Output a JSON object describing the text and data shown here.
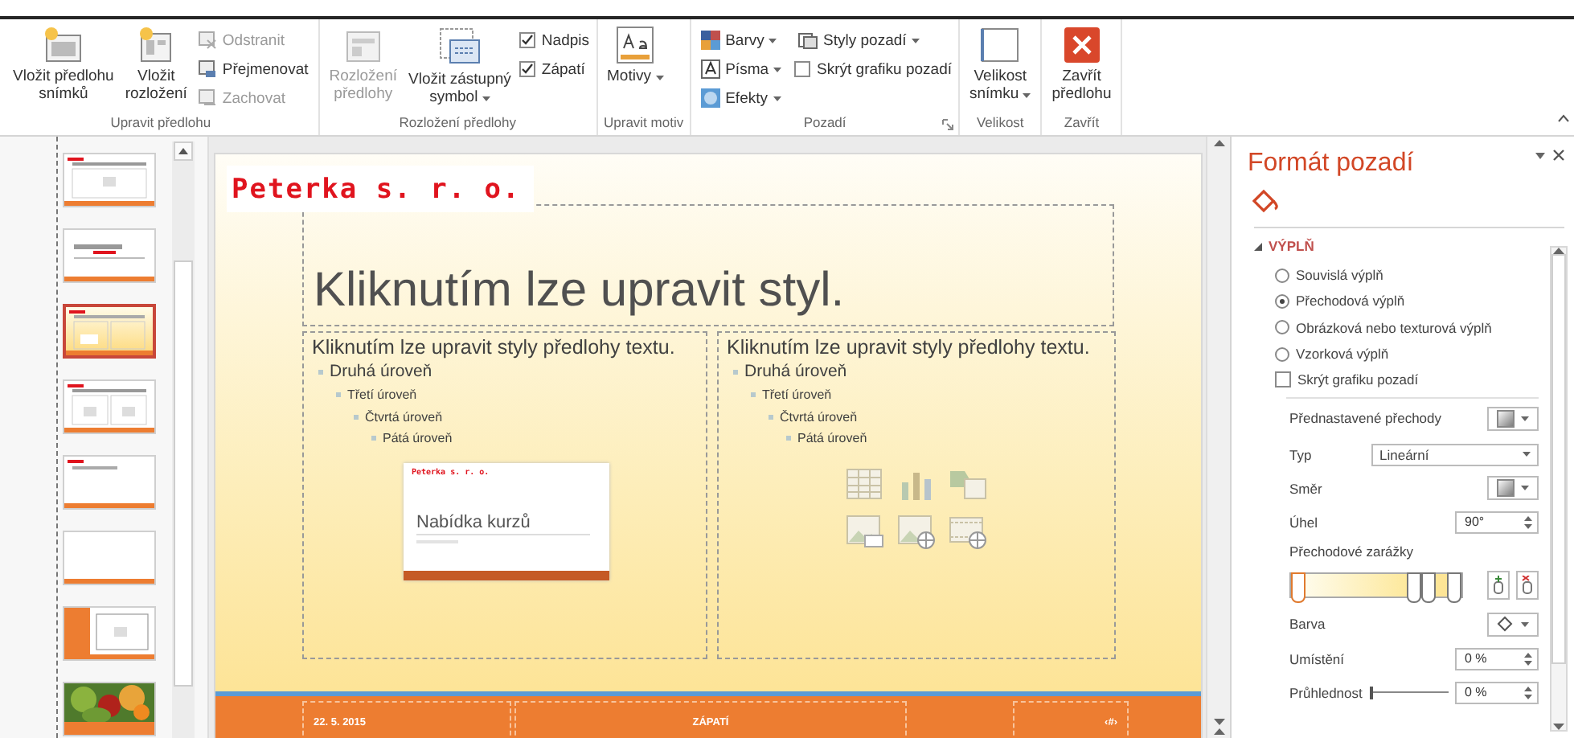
{
  "ribbon": {
    "groups": [
      {
        "label": "Upravit předlohu",
        "items": [
          {
            "kind": "large",
            "label": "Vložit předlohu\nsnímků",
            "disabled": false
          },
          {
            "kind": "large",
            "label": "Vložit\nrozložení",
            "disabled": false
          },
          {
            "kind": "small",
            "label": "Odstranit",
            "disabled": true
          },
          {
            "kind": "small",
            "label": "Přejmenovat",
            "disabled": false
          },
          {
            "kind": "small",
            "label": "Zachovat",
            "disabled": true
          }
        ]
      },
      {
        "label": "Rozložení předlohy",
        "items": [
          {
            "kind": "large",
            "label": "Rozložení\npředlohy",
            "disabled": true
          },
          {
            "kind": "large",
            "label": "Vložit zástupný\nsymbol",
            "disabled": false,
            "dropdown": true
          },
          {
            "kind": "check",
            "label": "Nadpis",
            "checked": true
          },
          {
            "kind": "check",
            "label": "Zápatí",
            "checked": true
          }
        ]
      },
      {
        "label": "Upravit motiv",
        "items": [
          {
            "kind": "large",
            "label": "Motivy",
            "disabled": false,
            "dropdown": true
          }
        ]
      },
      {
        "label": "Pozadí",
        "launcher": true,
        "items": [
          {
            "kind": "small",
            "label": "Barvy",
            "disabled": false,
            "dropdown": true
          },
          {
            "kind": "small",
            "label": "Písma",
            "disabled": false,
            "dropdown": true
          },
          {
            "kind": "small",
            "label": "Efekty",
            "disabled": false,
            "dropdown": true
          },
          {
            "kind": "small",
            "label": "Styly pozadí",
            "disabled": false,
            "dropdown": true
          },
          {
            "kind": "check",
            "label": "Skrýt grafiku pozadí",
            "checked": false
          }
        ]
      },
      {
        "label": "Velikost",
        "items": [
          {
            "kind": "large",
            "label": "Velikost\nsnímku",
            "disabled": false,
            "dropdown": true
          }
        ]
      },
      {
        "label": "Zavřít",
        "items": [
          {
            "kind": "large",
            "label": "Zavřít\npředlohu",
            "disabled": false
          }
        ]
      }
    ]
  },
  "thumbnails": [
    {
      "kind": "title-content",
      "selected": false
    },
    {
      "kind": "title",
      "selected": false
    },
    {
      "kind": "two-content",
      "selected": true
    },
    {
      "kind": "comparison",
      "selected": false
    },
    {
      "kind": "title-only",
      "selected": false
    },
    {
      "kind": "blank",
      "selected": false
    },
    {
      "kind": "content-caption",
      "selected": false
    },
    {
      "kind": "picture-caption",
      "selected": false
    }
  ],
  "slide": {
    "logo": "Peterka s. r. o.",
    "title": "Kliknutím lze upravit styl.",
    "body_boxes": [
      {
        "kind": "slide-preview",
        "outline": [
          {
            "text": "Kliknutím lze upravit styly předlohy textu.",
            "children": [
              {
                "text": "Druhá úroveň",
                "children": [
                  {
                    "text": "Třetí úroveň",
                    "children": [
                      {
                        "text": "Čtvrtá úroveň",
                        "children": [
                          {
                            "text": "Pátá úroveň"
                          }
                        ]
                      }
                    ]
                  }
                ]
              }
            ]
          }
        ],
        "preview": {
          "logo": "Peterka s. r. o.",
          "title": "Nabídka kurzů"
        }
      },
      {
        "kind": "content-icons",
        "outline": [
          {
            "text": "Kliknutím lze upravit styly předlohy textu.",
            "children": [
              {
                "text": "Druhá úroveň",
                "children": [
                  {
                    "text": "Třetí úroveň",
                    "children": [
                      {
                        "text": "Čtvrtá úroveň",
                        "children": [
                          {
                            "text": "Pátá úroveň"
                          }
                        ]
                      }
                    ]
                  }
                ]
              }
            ]
          }
        ]
      }
    ],
    "footer": {
      "date": "22. 5. 2015",
      "text": "ZÁPATÍ",
      "number": "‹#›"
    }
  },
  "format_pane": {
    "title": "Formát pozadí",
    "section": {
      "label": "VÝPLŇ",
      "expanded": true
    },
    "fill_options": [
      {
        "label": "Souvislá výplň",
        "selected": false
      },
      {
        "label": "Přechodová výplň",
        "selected": true
      },
      {
        "label": "Obrázková nebo texturová výplň",
        "selected": false
      },
      {
        "label": "Vzorková výplň",
        "selected": false
      }
    ],
    "hide_graphics": {
      "label": "Skrýt grafiku pozadí",
      "checked": false
    },
    "preset": {
      "label": "Přednastavené přechody"
    },
    "type": {
      "label": "Typ",
      "value": "Lineární"
    },
    "direction": {
      "label": "Směr"
    },
    "angle": {
      "label": "Úhel",
      "value": "90°"
    },
    "stops": {
      "label": "Přechodové zarážky",
      "items": [
        {
          "level": 0.04,
          "selected": true
        },
        {
          "level": 0.72,
          "selected": false
        },
        {
          "level": 0.8,
          "selected": false
        },
        {
          "level": 0.95,
          "selected": false
        }
      ]
    },
    "color": {
      "label": "Barva"
    },
    "position": {
      "label": "Umístění",
      "value": "0 %"
    },
    "transparency": {
      "label": "Průhlednost",
      "value": "0 %",
      "level": 0
    }
  }
}
